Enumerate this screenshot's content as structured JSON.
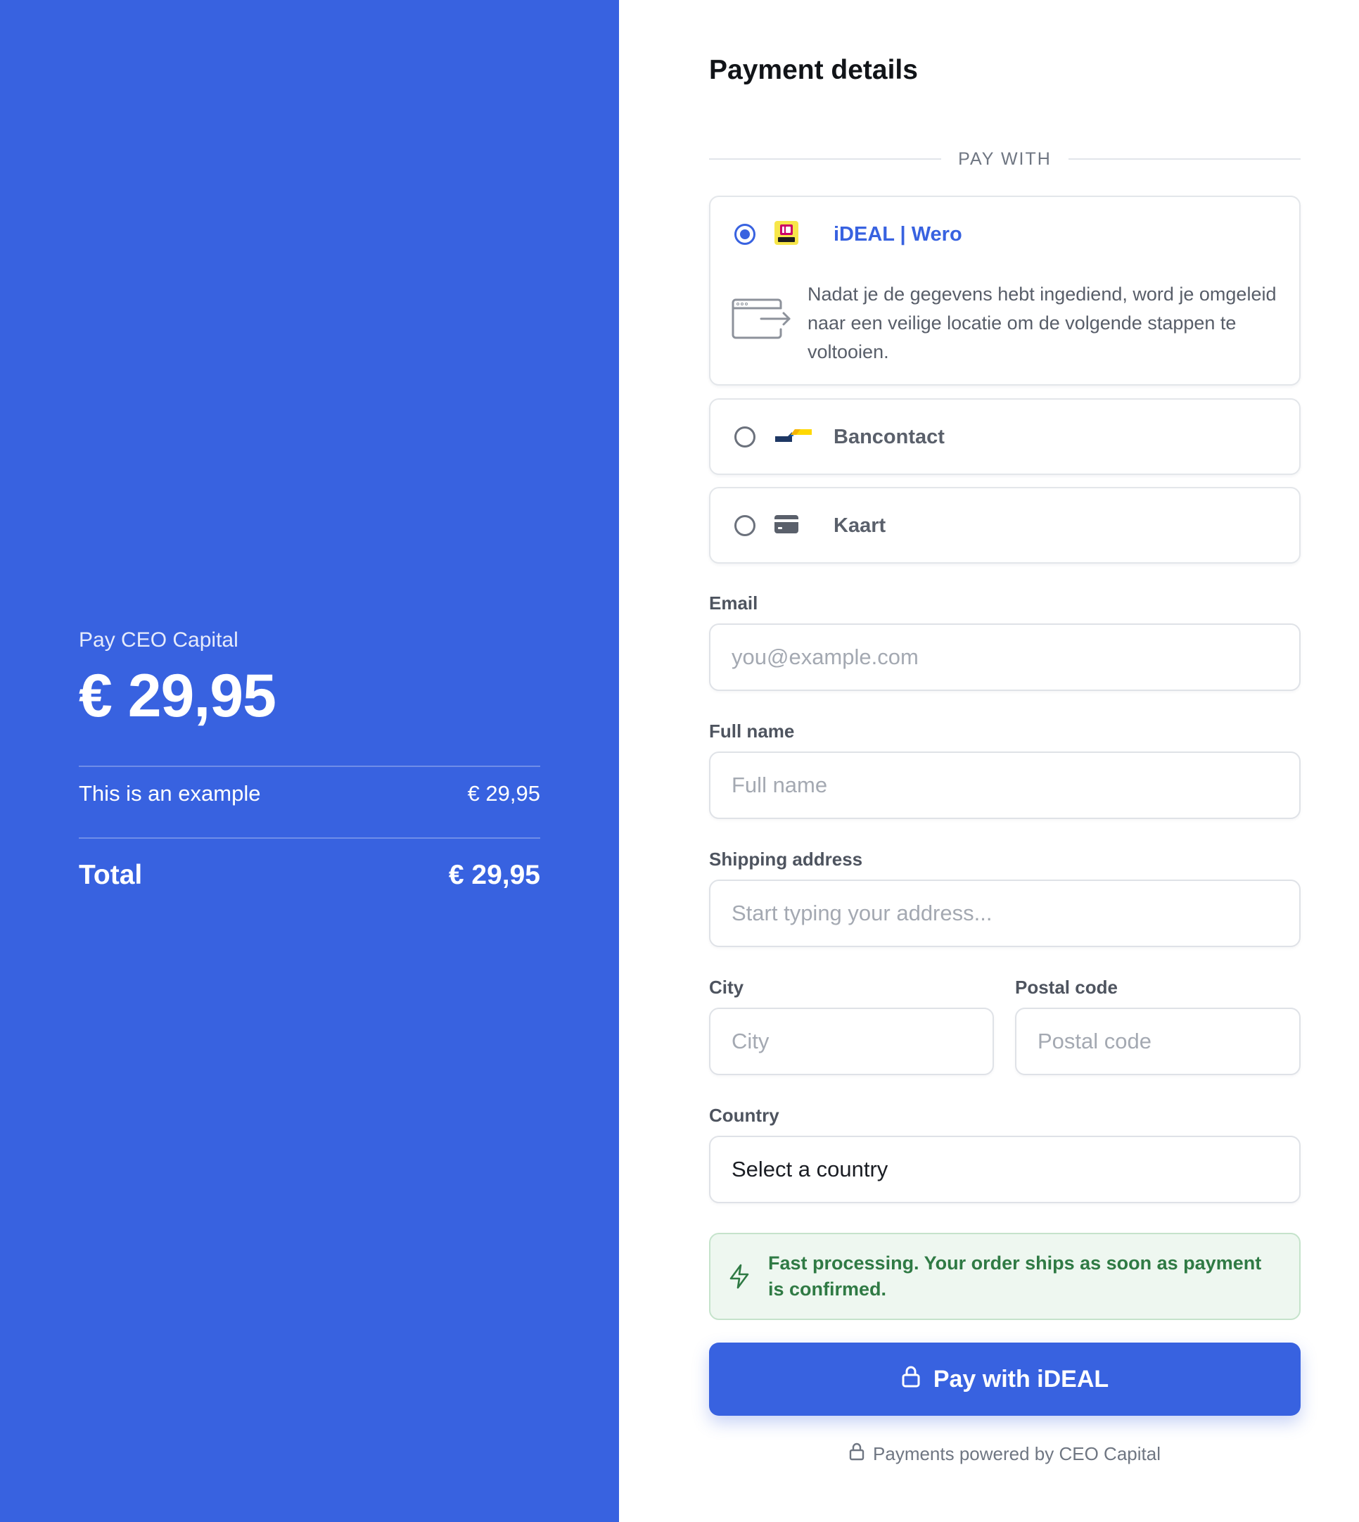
{
  "summary": {
    "merchant": "Pay CEO Capital",
    "amount": "€ 29,95",
    "item_name": "This is an example",
    "item_price": "€ 29,95",
    "total_label": "Total",
    "total_amount": "€ 29,95"
  },
  "form": {
    "heading": "Payment details",
    "pay_with": "PAY WITH",
    "methods": [
      {
        "label": "iDEAL | Wero",
        "selected": true,
        "icon": "ideal-wero-logo"
      },
      {
        "label": "Bancontact",
        "selected": false,
        "icon": "bancontact-logo"
      },
      {
        "label": "Kaart",
        "selected": false,
        "icon": "credit-card-icon"
      }
    ],
    "redirect_text": "Nadat je de gegevens hebt ingediend, word je omgeleid naar een veilige locatie om de volgende stappen te voltooien.",
    "email": {
      "label": "Email",
      "placeholder": "you@example.com"
    },
    "full_name": {
      "label": "Full name",
      "placeholder": "Full name"
    },
    "shipping": {
      "label": "Shipping address",
      "placeholder": "Start typing your address..."
    },
    "city": {
      "label": "City",
      "placeholder": "City"
    },
    "postal": {
      "label": "Postal code",
      "placeholder": "Postal code"
    },
    "country": {
      "label": "Country",
      "value": "Select a country"
    },
    "notice": "Fast processing. Your order ships as soon as payment is confirmed.",
    "pay_button": "Pay with iDEAL",
    "powered_by": "Payments powered by CEO Capital"
  },
  "colors": {
    "brand_blue": "#3862e0",
    "notice_green": "#2f7a44",
    "notice_bg": "#eef7f0"
  }
}
